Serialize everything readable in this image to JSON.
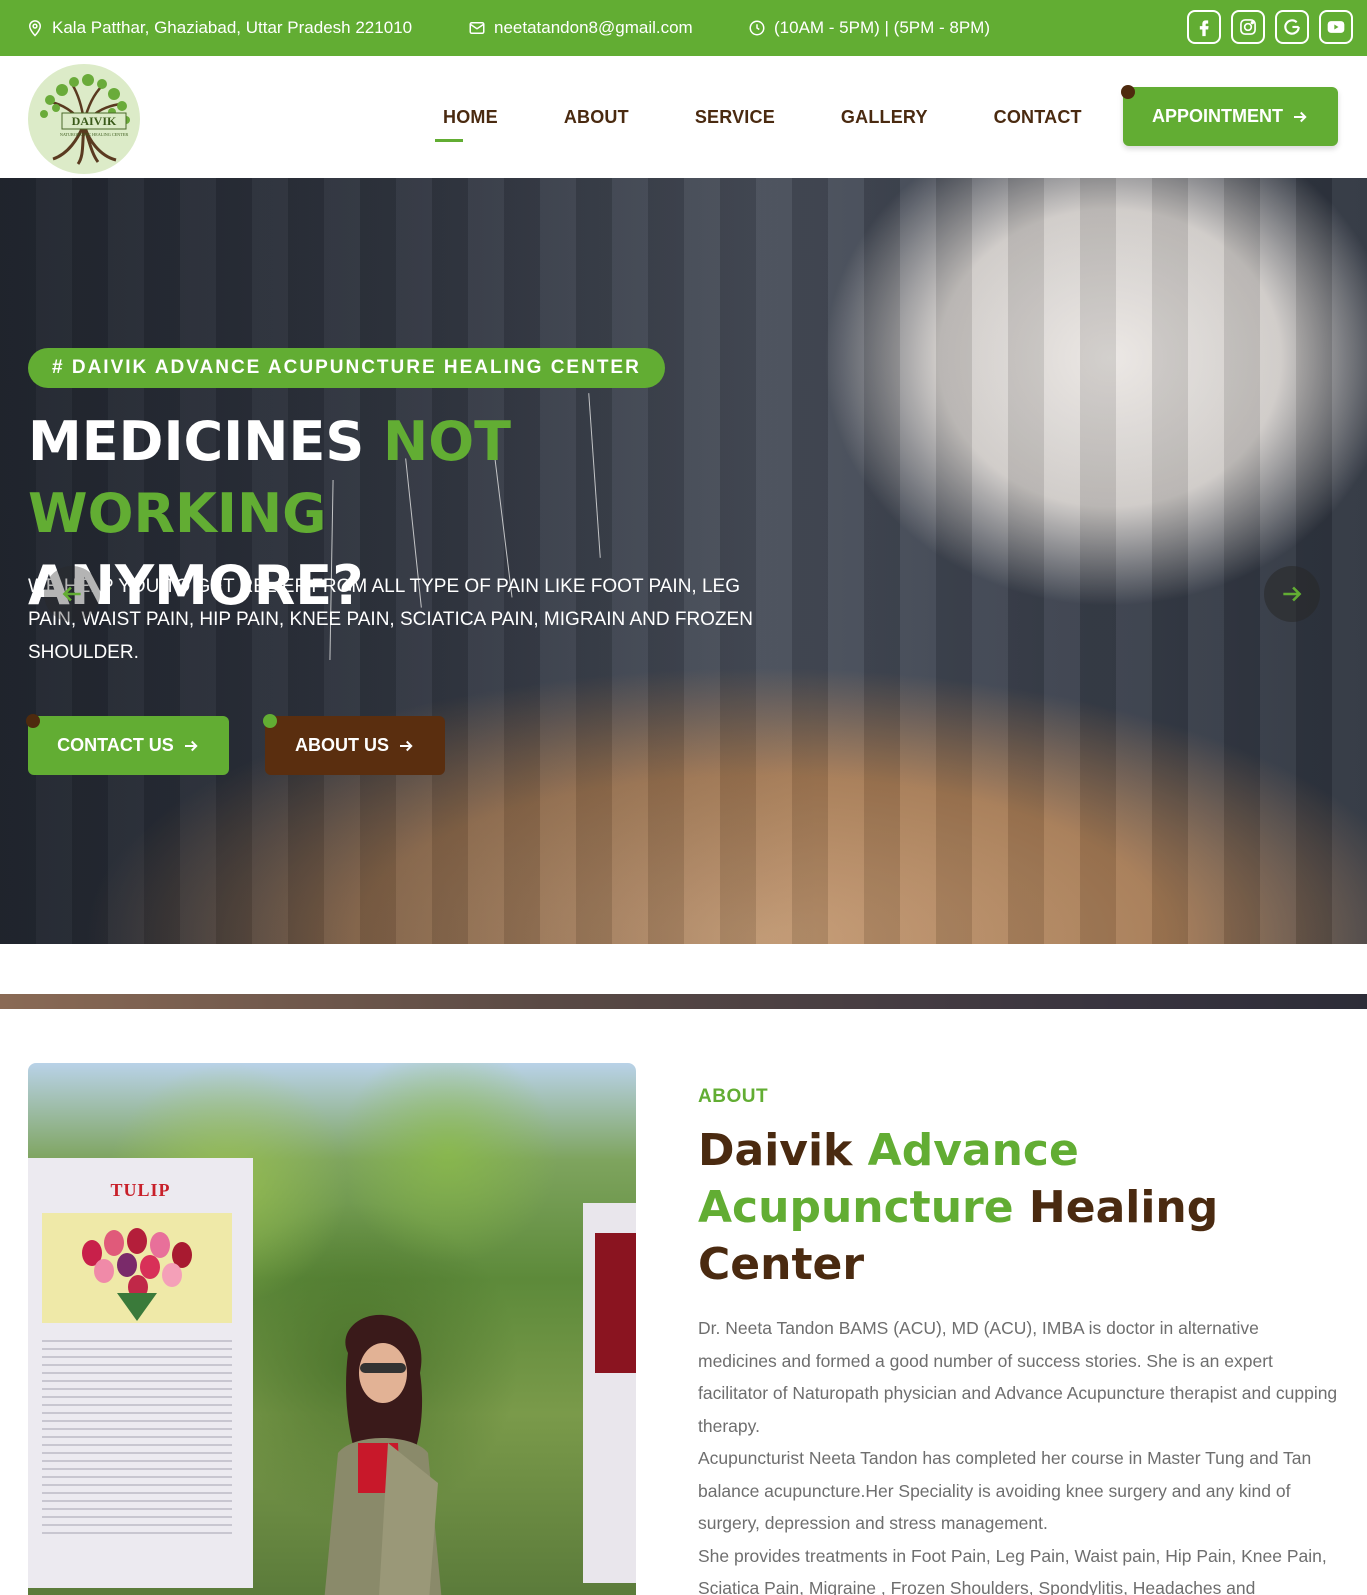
{
  "topbar": {
    "address": "Kala Patthar, Ghaziabad, Uttar Pradesh 221010",
    "email": "neetatandon8@gmail.com",
    "hours": "(10AM - 5PM) | (5PM - 8PM)",
    "socials": [
      "facebook-icon",
      "instagram-icon",
      "google-icon",
      "youtube-icon"
    ]
  },
  "header": {
    "logo_text": "DAIVIK",
    "logo_subtext": "NATUROPATHIC HEALING CENTER",
    "nav": [
      "HOME",
      "ABOUT",
      "SERVICE",
      "GALLERY",
      "CONTACT"
    ],
    "active_nav": "HOME",
    "appointment_label": "APPOINTMENT"
  },
  "hero": {
    "badge": "# DAIVIK ADVANCE ACUPUNCTURE HEALING CENTER",
    "title_part1": "MEDICINES ",
    "title_highlight": "NOT WORKING",
    "title_part2": "ANYMORE?",
    "description": "WE HELP YOU TO GET RELIEF FROM ALL TYPE OF PAIN LIKE FOOT PAIN, LEG PAIN, WAIST PAIN, HIP PAIN, KNEE PAIN, SCIATICA PAIN, MIGRAIN AND FROZEN SHOULDER.",
    "contact_button": "CONTACT US",
    "about_button": "ABOUT US"
  },
  "about": {
    "image_sign_text": "TULIP",
    "label": "ABOUT",
    "title_word1": "Daivik ",
    "title_highlight": "Advance Acupuncture",
    "title_word2": " Healing Center",
    "paragraphs": [
      "Dr. Neeta Tandon BAMS (ACU), MD (ACU), IMBA is doctor in alternative medicines and formed a good number of success stories. She is an expert facilitator of Naturopath physician and Advance Acupuncture therapist and cupping therapy.",
      "Acupuncturist Neeta Tandon has completed her course in Master Tung and Tan balance acupuncture.Her Speciality  is avoiding knee surgery and any kind of surgery, depression and stress management.",
      "She provides treatments in Foot Pain, Leg Pain, Waist pain, Hip Pain, Knee Pain, Sciatica Pain, Migraine , Frozen Shoulders, Spondylitis, Headaches  and"
    ]
  },
  "colors": {
    "accent_green": "#62ad33",
    "brand_brown": "#5a2e0f"
  }
}
